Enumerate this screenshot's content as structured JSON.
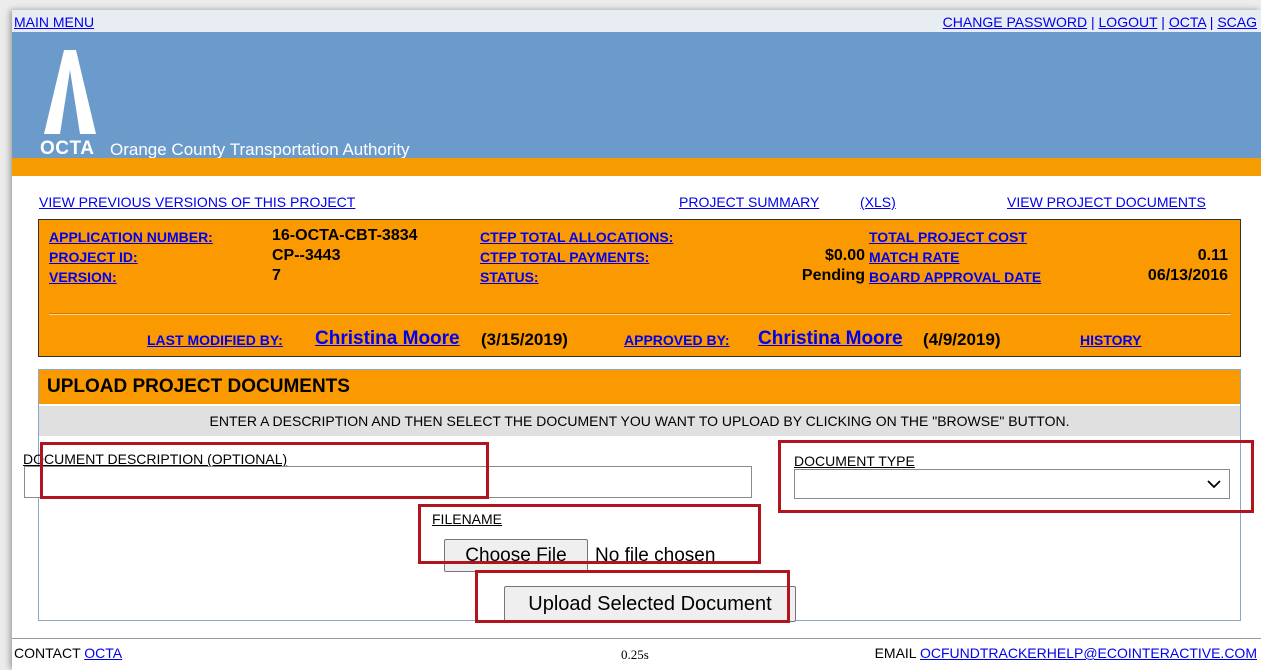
{
  "topbar": {
    "main_menu": "MAIN MENU",
    "change_password": "CHANGE PASSWORD",
    "logout": "LOGOUT",
    "octa": "OCTA",
    "scag": "SCAG",
    "separator": "|"
  },
  "banner": {
    "logo_text": "OCTA",
    "org_name": "Orange County Transportation Authority",
    "logo_icon": "road-logo-icon"
  },
  "links": {
    "view_previous": "VIEW PREVIOUS VERSIONS OF THIS PROJECT",
    "project_summary": "PROJECT SUMMARY",
    "xls": "(XLS)",
    "view_documents": "VIEW PROJECT DOCUMENTS"
  },
  "project": {
    "application_number_label": "APPLICATION NUMBER:",
    "application_number": "16-OCTA-CBT-3834",
    "project_id_label": "PROJECT ID:",
    "project_id": "CP--3443",
    "version_label": "VERSION:",
    "version": "7",
    "ctfp_alloc_label": "CTFP TOTAL ALLOCATIONS:",
    "ctfp_alloc": "",
    "ctfp_pay_label": "CTFP TOTAL PAYMENTS:",
    "ctfp_pay": "$0.00",
    "status_label": "STATUS:",
    "status": "Pending",
    "total_cost_label": "TOTAL PROJECT COST",
    "total_cost": "",
    "match_rate_label": "MATCH RATE",
    "match_rate": "0.11",
    "board_date_label": "BOARD APPROVAL DATE",
    "board_date": "06/13/2016",
    "last_modified_label": "LAST MODIFIED BY:",
    "last_modified_name": "Christina Moore",
    "last_modified_date": "(3/15/2019)",
    "approved_label": "APPROVED BY:",
    "approved_name": "Christina Moore",
    "approved_date": "(4/9/2019)",
    "history": "HISTORY"
  },
  "upload": {
    "title": "UPLOAD PROJECT DOCUMENTS",
    "instructions": "ENTER A DESCRIPTION AND THEN SELECT THE DOCUMENT YOU WANT TO UPLOAD BY CLICKING ON THE \"BROWSE\" BUTTON.",
    "description_label": "DOCUMENT DESCRIPTION (OPTIONAL)",
    "description_value": "",
    "type_label": "DOCUMENT TYPE",
    "type_value": "",
    "filename_label": "FILENAME",
    "choose_file": "Choose File",
    "no_file": "No file chosen",
    "upload_button": "Upload Selected Document"
  },
  "footer": {
    "contact_label": "CONTACT",
    "contact_link": "OCTA",
    "timing": "0.25s",
    "email_label": "EMAIL",
    "email": "OCFUNDTRACKERHELP@ECOINTERACTIVE.COM"
  },
  "colors": {
    "banner": "#6a9bcb",
    "orange": "#fb9a00",
    "highlight": "#b0141c",
    "link": "#0000ee"
  }
}
